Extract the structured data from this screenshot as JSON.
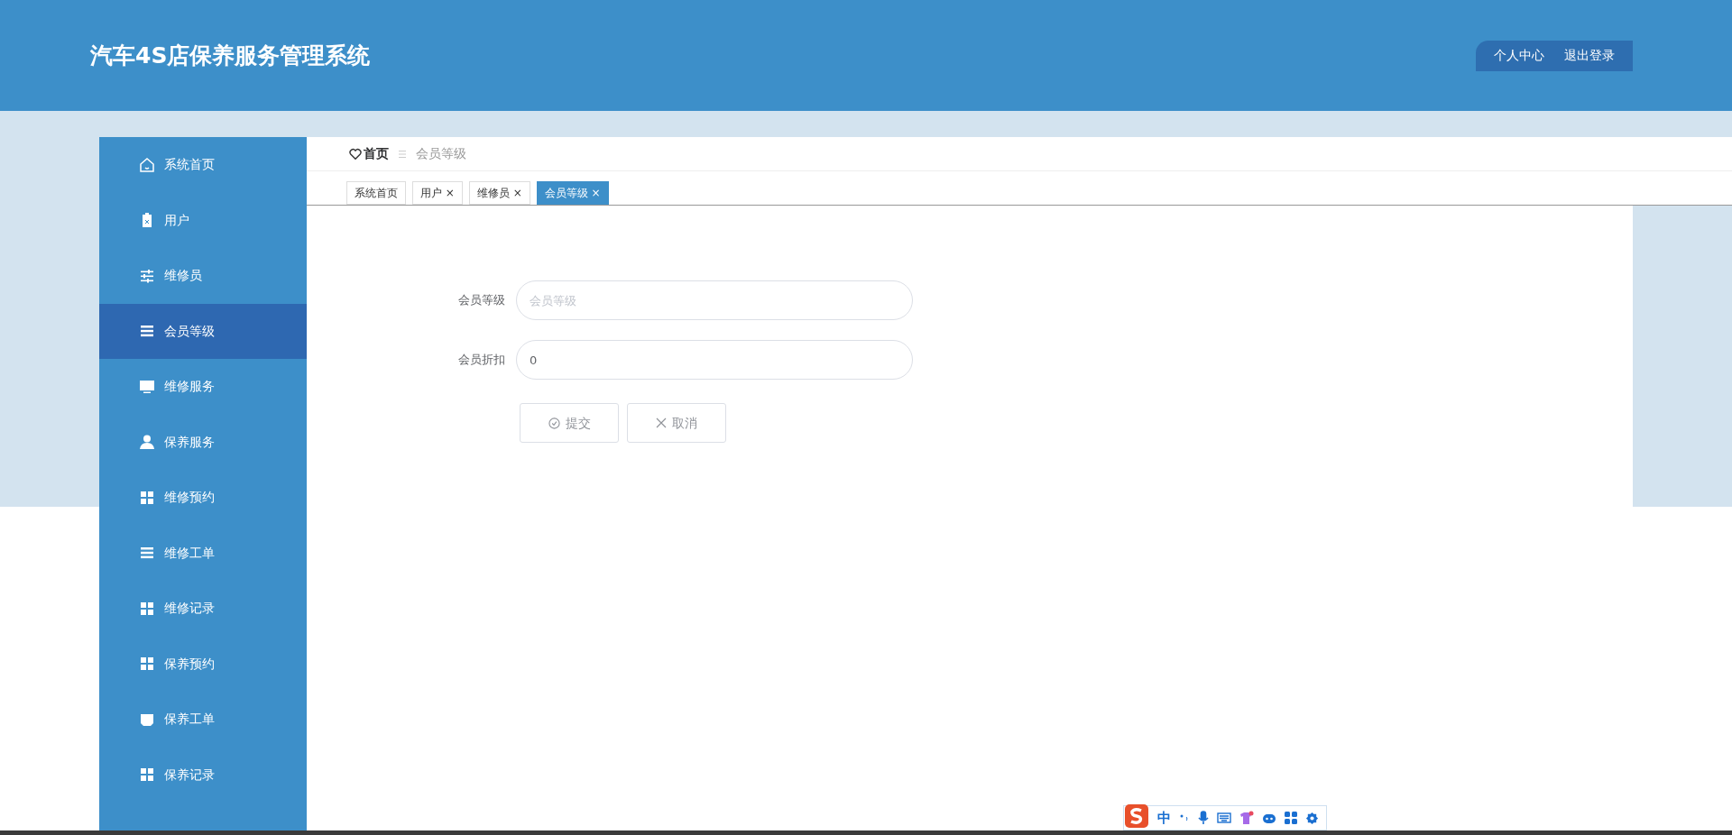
{
  "header": {
    "title": "汽车4S店保养服务管理系统",
    "buttons": [
      "个人中心",
      "退出登录"
    ]
  },
  "sidebar": {
    "items": [
      {
        "label": "系统首页",
        "kind": "home",
        "selected": false
      },
      {
        "label": "用户",
        "kind": "clipboard",
        "selected": false
      },
      {
        "label": "维修员",
        "kind": "sliders",
        "selected": false
      },
      {
        "label": "会员等级",
        "kind": "list",
        "selected": true
      },
      {
        "label": "维修服务",
        "kind": "monitor",
        "selected": false
      },
      {
        "label": "保养服务",
        "kind": "user",
        "selected": false
      },
      {
        "label": "维修预约",
        "kind": "grid",
        "selected": false
      },
      {
        "label": "维修工单",
        "kind": "list",
        "selected": false
      },
      {
        "label": "维修记录",
        "kind": "grid",
        "selected": false
      },
      {
        "label": "保养预约",
        "kind": "grid",
        "selected": false
      },
      {
        "label": "保养工单",
        "kind": "tray",
        "selected": false
      },
      {
        "label": "保养记录",
        "kind": "grid",
        "selected": false
      }
    ]
  },
  "breadcrumb": {
    "home": "首页",
    "current": "会员等级"
  },
  "tabs": [
    {
      "label": "系统首页",
      "selected": false
    },
    {
      "label": "用户",
      "close": "×",
      "selected": false
    },
    {
      "label": "维修员",
      "close": "×",
      "selected": false
    },
    {
      "label": "会员等级",
      "close": "×",
      "selected": true
    }
  ],
  "form": {
    "fields": [
      {
        "label": "会员等级",
        "placeholder": "会员等级"
      },
      {
        "label": "会员折扣",
        "value": "0"
      }
    ],
    "buttons": [
      {
        "label": "提交",
        "kind": "submit"
      },
      {
        "label": "取消",
        "kind": "cancel"
      }
    ]
  },
  "ime_toolbar": {
    "mode": "中"
  }
}
